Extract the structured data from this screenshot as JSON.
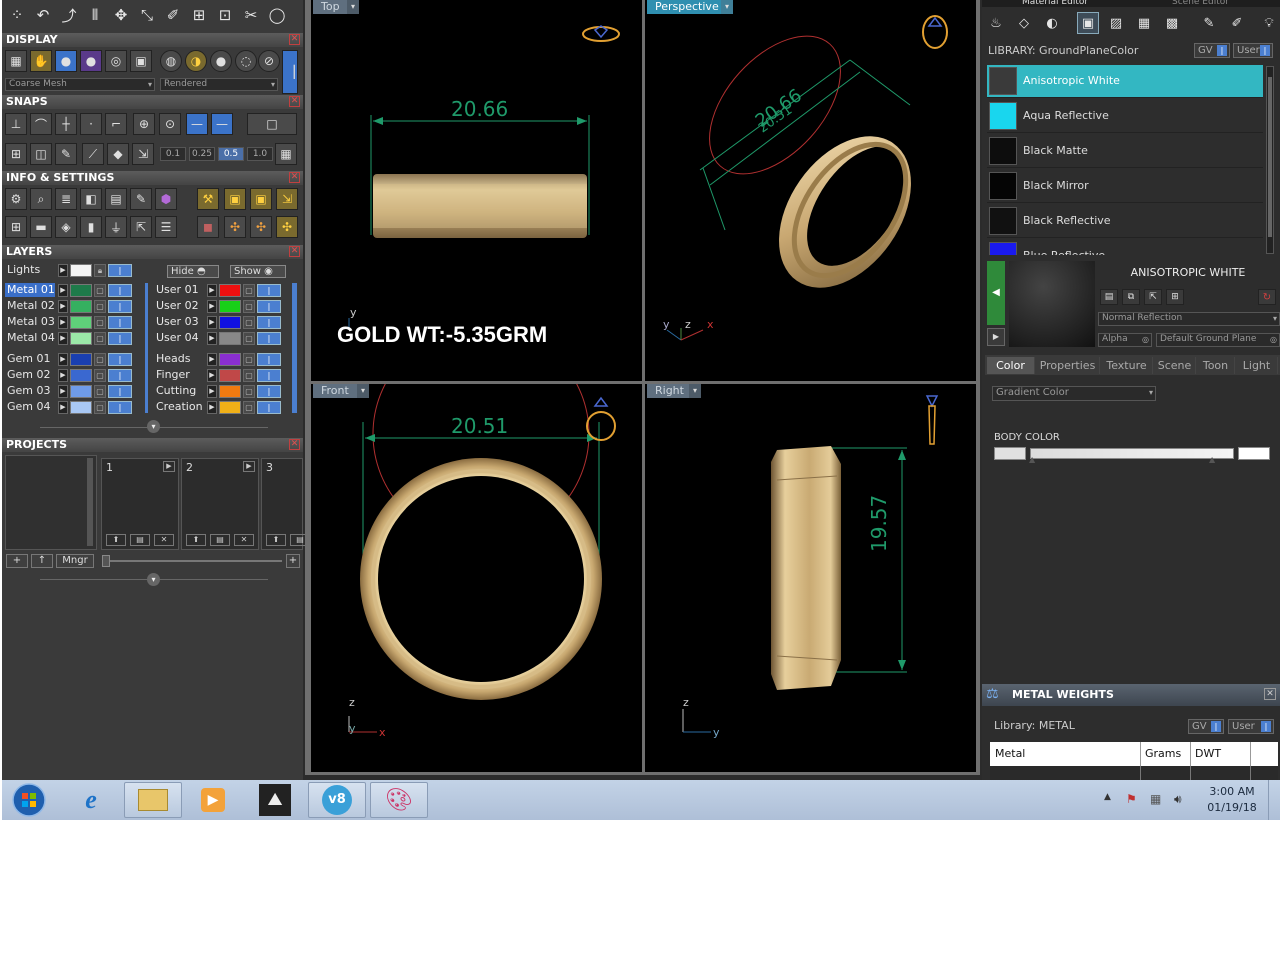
{
  "display": {
    "title": "DISPLAY",
    "mesh_select": "Coarse Mesh",
    "render_select": "Rendered"
  },
  "snaps": {
    "title": "SNAPS",
    "values": [
      "0.1",
      "0.25",
      "0.5",
      "1.0"
    ]
  },
  "info": {
    "title": "INFO & SETTINGS"
  },
  "layers": {
    "title": "LAYERS",
    "lights_label": "Lights",
    "hide_label": "Hide",
    "show_label": "Show",
    "left": [
      {
        "label": "Metal 01",
        "color": "#1e7a4a"
      },
      {
        "label": "Metal 02",
        "color": "#35b060"
      },
      {
        "label": "Metal 03",
        "color": "#5fd07a"
      },
      {
        "label": "Metal 04",
        "color": "#9be8a8"
      },
      {
        "label": "Gem 01",
        "color": "#1a3fb0"
      },
      {
        "label": "Gem 02",
        "color": "#3a68d0"
      },
      {
        "label": "Gem 03",
        "color": "#6f9be8"
      },
      {
        "label": "Gem 04",
        "color": "#a9c8f4"
      }
    ],
    "right": [
      {
        "label": "User 01",
        "color": "#ee1010"
      },
      {
        "label": "User 02",
        "color": "#18d018"
      },
      {
        "label": "User 03",
        "color": "#1010e0"
      },
      {
        "label": "User 04",
        "color": "#888888"
      },
      {
        "label": "Heads",
        "color": "#8a2fd0"
      },
      {
        "label": "Finger",
        "color": "#c04848"
      },
      {
        "label": "Cutting",
        "color": "#f07a10"
      },
      {
        "label": "Creation",
        "color": "#f0b018"
      }
    ]
  },
  "projects": {
    "title": "PROJECTS",
    "slots": [
      "1",
      "2",
      "3"
    ],
    "add": "+",
    "up": "↑",
    "manager": "Mngr"
  },
  "viewports": {
    "top": {
      "tab": "Top",
      "dimension": "20.66",
      "note": "GOLD WT:-5.35GRM"
    },
    "perspective": {
      "tab": "Perspective",
      "dimension": "20.66",
      "dimension2": "20.51"
    },
    "front": {
      "tab": "Front",
      "dimension": "20.51"
    },
    "right": {
      "tab": "Right",
      "dimension": "19.57"
    },
    "axes": {
      "x": "x",
      "y": "y",
      "z": "z"
    }
  },
  "material_editor": {
    "tab_material": "Material Editor",
    "tab_scene": "Scene Editor",
    "library_label": "LIBRARY: GroundPlaneColor",
    "gv": "GV",
    "user": "User",
    "items": [
      {
        "name": "Anisotropic White",
        "color": "#3a3a3a"
      },
      {
        "name": "Aqua Reflective",
        "color": "#19d6ee"
      },
      {
        "name": "Black Matte",
        "color": "#0d0d0d"
      },
      {
        "name": "Black Mirror",
        "color": "#050505"
      },
      {
        "name": "Black Reflective",
        "color": "#111111"
      },
      {
        "name": "Blue Reflective",
        "color": "#1a1aee"
      }
    ],
    "selected_title": "ANISOTROPIC WHITE",
    "reflection_select": "Normal Reflection",
    "alpha_label": "Alpha",
    "ground_select": "Default Ground Plane",
    "prop_tabs": [
      "Color",
      "Properties",
      "Texture",
      "Scene",
      "Toon",
      "Light"
    ],
    "gradient_select": "Gradient Color",
    "body_color_label": "BODY COLOR"
  },
  "metal_weights": {
    "title": "METAL WEIGHTS",
    "library_label": "Library: METAL",
    "gv": "GV",
    "user": "User",
    "columns": [
      "Metal",
      "Grams",
      "DWT"
    ]
  },
  "taskbar": {
    "time": "3:00 AM",
    "date": "01/19/18"
  }
}
